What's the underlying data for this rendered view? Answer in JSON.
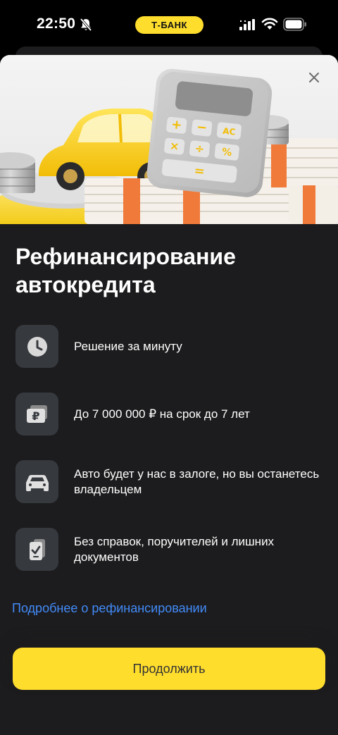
{
  "status_bar": {
    "time": "22:50",
    "bank_badge": "Т-БАНК",
    "icons": [
      "bell-off-icon",
      "signal-icon",
      "wifi-icon",
      "battery-icon"
    ]
  },
  "sheet": {
    "close_icon": "close-icon",
    "hero_image": "car-calculator-money-illustration",
    "title": "Рефинансирование автокредита",
    "features": [
      {
        "icon": "clock-icon",
        "text": "Решение за минуту"
      },
      {
        "icon": "ruble-card-icon",
        "text": "До 7 000 000 ₽ на срок до 7 лет"
      },
      {
        "icon": "car-icon",
        "text": "Авто будет у нас в залоге, но вы останетесь владельцем"
      },
      {
        "icon": "document-check-icon",
        "text": "Без справок, поручителей и лишних документов"
      }
    ],
    "more_link": "Подробнее о рефинансировании",
    "continue_button": "Продолжить"
  },
  "colors": {
    "accent": "#ffdd2d",
    "link": "#428bf9",
    "sheet_bg": "#1c1c1e",
    "icon_bg": "#36393e"
  }
}
